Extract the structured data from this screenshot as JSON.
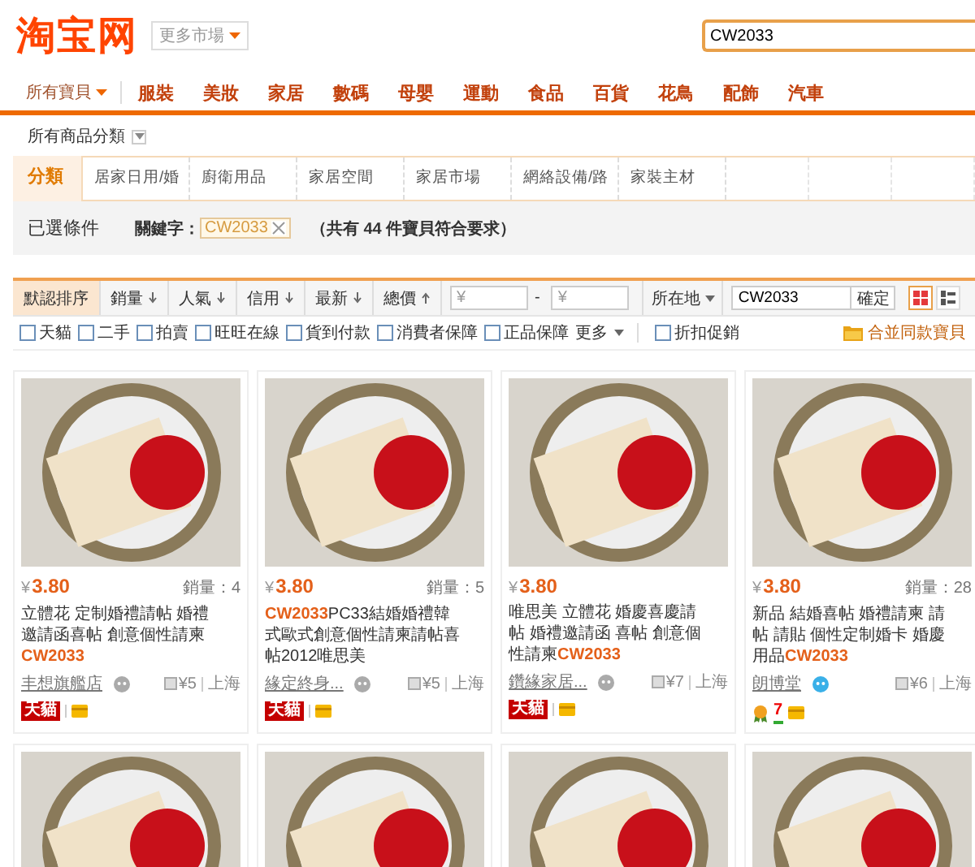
{
  "header": {
    "logo": "淘宝网",
    "market": "更多市場",
    "search": {
      "value": "CW2033"
    }
  },
  "nav": {
    "all": "所有寶貝",
    "items": [
      "服裝",
      "美妝",
      "家居",
      "數碼",
      "母嬰",
      "運動",
      "食品",
      "百貨",
      "花鳥",
      "配飾",
      "汽車"
    ]
  },
  "category_toggle": "所有商品分類",
  "categories": {
    "label": "分類",
    "items": [
      "居家日用/婚",
      "廚衛用品",
      "家居空間",
      "家居市場",
      "網絡設備/路",
      "家裝主材"
    ]
  },
  "conditions": {
    "label": "已選條件",
    "keyword_label": "關鍵字：",
    "keyword": "CW2033",
    "summary": "（共有 **44** 件寶貝符合要求）"
  },
  "sort": {
    "options": [
      {
        "label": "默認排序",
        "kind": "none",
        "selected": true
      },
      {
        "label": "銷量",
        "kind": "desc",
        "selected": false
      },
      {
        "label": "人氣",
        "kind": "desc",
        "selected": false
      },
      {
        "label": "信用",
        "kind": "desc",
        "selected": false
      },
      {
        "label": "最新",
        "kind": "desc",
        "selected": false
      },
      {
        "label": "總價",
        "kind": "asc",
        "selected": false
      }
    ],
    "price_from": {
      "placeholder": "¥"
    },
    "price_to": {
      "placeholder": "¥"
    },
    "dash": "-",
    "location": "所在地",
    "query": {
      "value": "CW2033"
    },
    "confirm": "確定",
    "views": [
      {
        "kind": "grid",
        "selected": true
      },
      {
        "kind": "list",
        "selected": false
      }
    ]
  },
  "filters": [
    {
      "label": "天貓",
      "kind": "checkbox",
      "checked": false
    },
    {
      "label": "二手",
      "kind": "checkbox",
      "checked": false
    },
    {
      "label": "拍賣",
      "kind": "checkbox",
      "checked": false
    },
    {
      "label": "旺旺在線",
      "kind": "checkbox",
      "checked": false
    },
    {
      "label": "貨到付款",
      "kind": "checkbox",
      "checked": false
    },
    {
      "label": "消費者保障",
      "kind": "checkbox",
      "checked": false
    },
    {
      "label": "正品保障",
      "kind": "checkbox",
      "checked": false
    },
    {
      "label": "更多",
      "kind": "dropdown"
    },
    {
      "label": "折扣促銷",
      "kind": "checkbox",
      "checked": false
    }
  ],
  "merge": "合並同款寶貝",
  "products": [
    {
      "kind": "full",
      "currency": "¥",
      "price": "3.80",
      "sales": "銷量：4",
      "title": "立體花 定制婚禮請帖 婚禮邀請函喜帖 創意個性請柬 **CW2033**",
      "shop": "丰想旗艦店",
      "color": "#aaaaaa",
      "shipping": "¥5",
      "location": "上海",
      "badges": [
        {
          "kind": "tmall",
          "label": "天貓"
        },
        {
          "kind": "card"
        }
      ]
    },
    {
      "kind": "full",
      "currency": "¥",
      "price": "3.80",
      "sales": "銷量：5",
      "title": "**CW2033**PC33結婚婚禮韓式歐式創意個性請柬請帖喜帖2012唯思美",
      "shop": "緣定終身...",
      "color": "#aaaaaa",
      "shipping": "¥5",
      "location": "上海",
      "badges": [
        {
          "kind": "tmall",
          "label": "天貓"
        },
        {
          "kind": "card"
        }
      ]
    },
    {
      "kind": "full",
      "currency": "¥",
      "price": "3.80",
      "title": "唯思美 立體花 婚慶喜慶請帖 婚禮邀請函 喜帖 創意個性請柬**CW2033**",
      "shop": "鑽緣家居...",
      "color": "#aaaaaa",
      "shipping": "¥7",
      "location": "上海",
      "badges": [
        {
          "kind": "tmall",
          "label": "天貓"
        },
        {
          "kind": "card"
        }
      ]
    },
    {
      "kind": "full",
      "currency": "¥",
      "price": "3.80",
      "sales": "銷量：28",
      "title": "新品 結婚喜帖 婚禮請柬 請帖 請貼 個性定制婚卡 婚慶用品**CW2033**",
      "shop": "朗博堂",
      "color": "#3ab0e8",
      "shipping": "¥6",
      "location": "上海",
      "badges": [
        {
          "kind": "medal"
        },
        {
          "kind": "seven",
          "label": "7"
        },
        {
          "kind": "card"
        }
      ]
    },
    {
      "kind": "image_only"
    },
    {
      "kind": "image_only"
    },
    {
      "kind": "image_only"
    },
    {
      "kind": "image_only"
    }
  ]
}
